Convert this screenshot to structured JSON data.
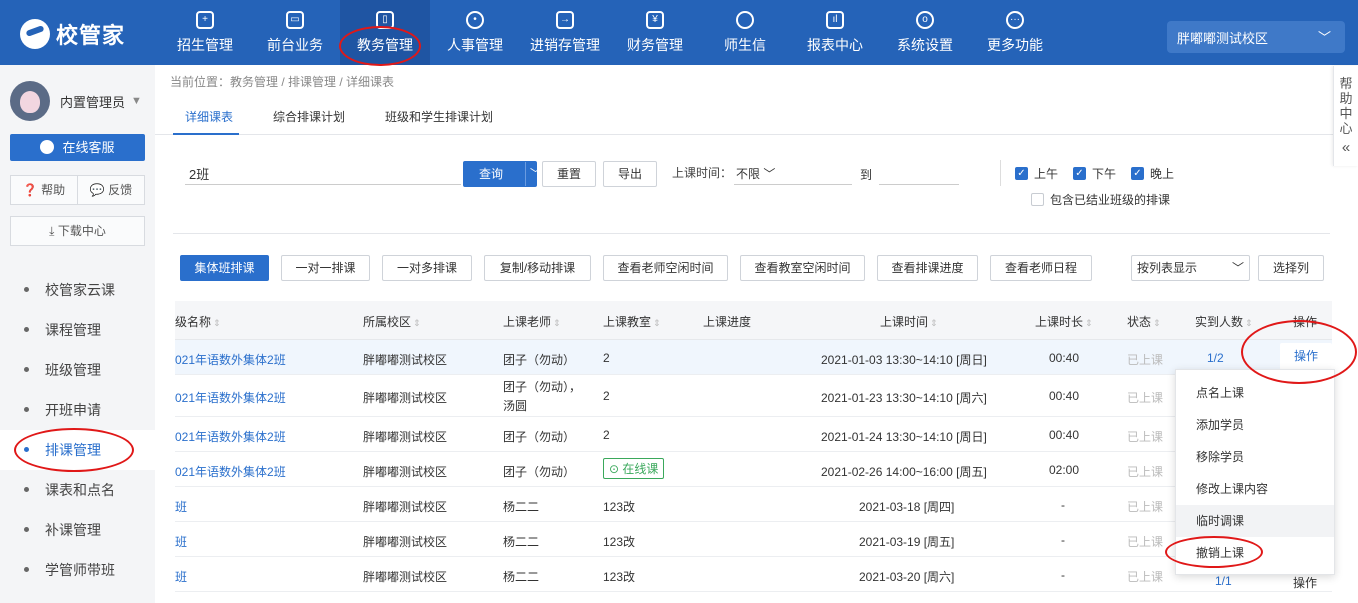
{
  "brand": {
    "name": "校管家"
  },
  "nav": [
    {
      "label": "招生管理",
      "icon": "person-plus-icon"
    },
    {
      "label": "前台业务",
      "icon": "monitor-icon"
    },
    {
      "label": "教务管理",
      "icon": "book-icon"
    },
    {
      "label": "人事管理",
      "icon": "person-icon"
    },
    {
      "label": "进销存管理",
      "icon": "exchange-icon"
    },
    {
      "label": "财务管理",
      "icon": "yen-icon"
    },
    {
      "label": "师生信",
      "icon": "chat-icon"
    },
    {
      "label": "报表中心",
      "icon": "chart-icon"
    },
    {
      "label": "系统设置",
      "icon": "settings-icon"
    },
    {
      "label": "更多功能",
      "icon": "more-icon"
    }
  ],
  "campus": {
    "label": "胖嘟嘟测试校区"
  },
  "sidebar": {
    "user_name": "内置管理员",
    "kefu_label": "在线客服",
    "help_label": "帮助",
    "feedback_label": "反馈",
    "download_label": "下载中心",
    "items": [
      {
        "label": "校管家云课"
      },
      {
        "label": "课程管理"
      },
      {
        "label": "班级管理"
      },
      {
        "label": "开班申请"
      },
      {
        "label": "排课管理"
      },
      {
        "label": "课表和点名"
      },
      {
        "label": "补课管理"
      },
      {
        "label": "学管师带班"
      }
    ]
  },
  "breadcrumb": "当前位置：教务管理 / 排课管理 / 详细课表",
  "tabs": [
    {
      "label": "详细课表"
    },
    {
      "label": "综合排课计划"
    },
    {
      "label": "班级和学生排课计划"
    }
  ],
  "filters": {
    "search_value": "2班",
    "query_label": "查询",
    "reset_label": "重置",
    "export_label": "导出",
    "time_label": "上课时间：",
    "time_value": "不限",
    "to_label": "到",
    "morning_label": "上午",
    "afternoon_label": "下午",
    "evening_label": "晚上",
    "include_graduated_label": "包含已结业班级的排课"
  },
  "actions": {
    "group": "集体班排课",
    "one_to_one": "一对一排课",
    "one_to_many": "一对多排课",
    "copy_move": "复制/移动排课",
    "teacher_free": "查看老师空闲时间",
    "room_free": "查看教室空闲时间",
    "progress": "查看排课进度",
    "teacher_schedule": "查看老师日程",
    "display_mode": "按列表显示",
    "choose_columns": "选择列"
  },
  "table": {
    "headers": {
      "class_name": "级名称",
      "campus": "所属校区",
      "teacher": "上课老师",
      "room": "上课教室",
      "progress": "上课进度",
      "time": "上课时间",
      "duration": "上课时长",
      "status": "状态",
      "attendance": "实到人数",
      "op": "操作"
    },
    "rows": [
      {
        "class_name": "021年语数外集体2班",
        "campus": "胖嘟嘟测试校区",
        "teacher": "团子（勿动）",
        "room": "2",
        "time": "2021-01-03 13:30~14:10 [周日]",
        "duration": "00:40",
        "status": "已上课",
        "attendance": "1/2",
        "op": "操作"
      },
      {
        "class_name": "021年语数外集体2班",
        "campus": "胖嘟嘟测试校区",
        "teacher": "团子（勿动），",
        "teacher2": "汤圆",
        "room": "2",
        "time": "2021-01-23 13:30~14:10 [周六]",
        "duration": "00:40",
        "status": "已上课"
      },
      {
        "class_name": "021年语数外集体2班",
        "campus": "胖嘟嘟测试校区",
        "teacher": "团子（勿动）",
        "room": "2",
        "time": "2021-01-24 13:30~14:10 [周日]",
        "duration": "00:40",
        "status": "已上课"
      },
      {
        "class_name": "021年语数外集体2班",
        "campus": "胖嘟嘟测试校区",
        "teacher": "团子（勿动）",
        "room_tag": "在线课",
        "time": "2021-02-26 14:00~16:00 [周五]",
        "duration": "02:00",
        "status": "已上课"
      },
      {
        "class_name": "班",
        "campus": "胖嘟嘟测试校区",
        "teacher": "杨二二",
        "room": "123改",
        "time": "2021-03-18 [周四]",
        "duration": "-",
        "status": "已上课"
      },
      {
        "class_name": "班",
        "campus": "胖嘟嘟测试校区",
        "teacher": "杨二二",
        "room": "123改",
        "time": "2021-03-19 [周五]",
        "duration": "-",
        "status": "已上课"
      },
      {
        "class_name": "班",
        "campus": "胖嘟嘟测试校区",
        "teacher": "杨二二",
        "room": "123改",
        "time": "2021-03-20 [周六]",
        "duration": "-",
        "status": "已上课",
        "attendance": "1/1",
        "op": "操作"
      }
    ]
  },
  "op_menu": [
    {
      "label": "点名上课"
    },
    {
      "label": "添加学员"
    },
    {
      "label": "移除学员"
    },
    {
      "label": "修改上课内容"
    },
    {
      "label": "临时调课"
    },
    {
      "label": "撤销上课"
    }
  ],
  "help_float": {
    "label": "帮助中心",
    "chars": [
      "帮",
      "助",
      "中",
      "心"
    ],
    "collapse": "«"
  },
  "colors": {
    "primary": "#2563b8",
    "accent": "#2a6fcc",
    "annotation": "#e01818",
    "online": "#3aa85b"
  }
}
